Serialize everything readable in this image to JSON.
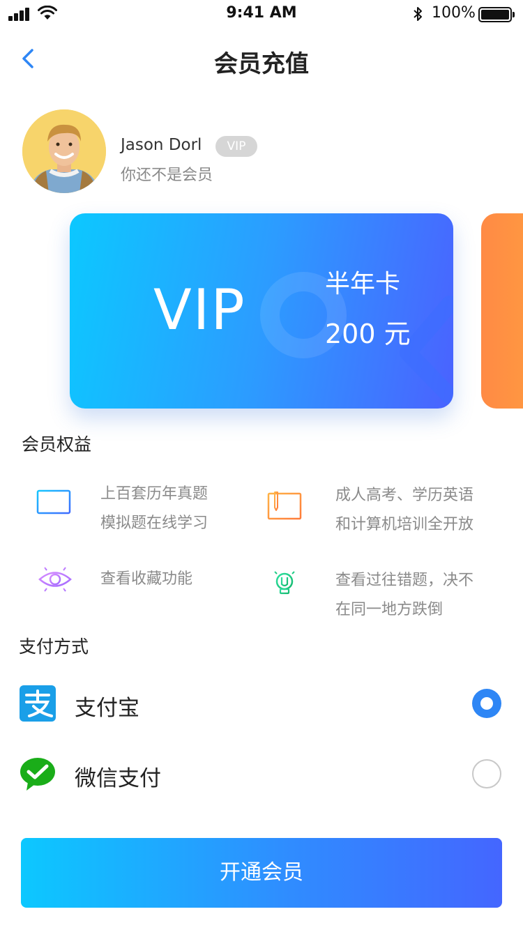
{
  "status_bar": {
    "time": "9:41 AM",
    "battery": "100%",
    "icons": [
      "signal-icon",
      "wifi-icon",
      "bluetooth-icon",
      "battery-icon"
    ]
  },
  "nav": {
    "title": "会员充值",
    "back_icon": "chevron-left-icon"
  },
  "user": {
    "name": "Jason Dorl",
    "badge": "VIP",
    "status": "你还不是会员"
  },
  "card": {
    "label": "VIP",
    "plan": "半年卡",
    "price": "200 元"
  },
  "benefits": {
    "title": "会员权益",
    "items": [
      {
        "icon": "monitor-icon",
        "line1": "上百套历年真题",
        "line2": "模拟题在线学习"
      },
      {
        "icon": "book-icon",
        "line1": "成人高考、学历英语",
        "line2": "和计算机培训全开放"
      },
      {
        "icon": "eye-icon",
        "line1": "查看收藏功能",
        "line2": ""
      },
      {
        "icon": "lightbulb-icon",
        "line1": "查看过往错题，决不",
        "line2": "在同一地方跌倒"
      }
    ]
  },
  "payment": {
    "title": "支付方式",
    "methods": [
      {
        "icon": "alipay-icon",
        "label": "支付宝",
        "selected": true
      },
      {
        "icon": "wechat-pay-icon",
        "label": "微信支付",
        "selected": false
      }
    ]
  },
  "submit": {
    "label": "开通会员"
  },
  "colors": {
    "accent": "#2e86f5",
    "gradient_start": "#0cc8ff",
    "gradient_end": "#4466ff",
    "alipay": "#1a9fe8",
    "wechat": "#1aad19",
    "secondary_card": "#ff8a45"
  }
}
